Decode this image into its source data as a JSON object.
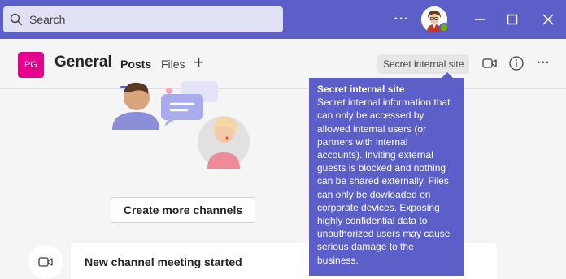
{
  "search": {
    "placeholder": "Search"
  },
  "titlebar": {
    "more": "···"
  },
  "team": {
    "initials": "PG"
  },
  "channel": {
    "title": "General",
    "tabs": [
      {
        "label": "Posts",
        "active": true
      },
      {
        "label": "Files",
        "active": false
      }
    ],
    "add_tab": "+",
    "sensitivity_label": "Secret internal site",
    "more": "···"
  },
  "tooltip": {
    "title": "Secret internal site",
    "body": "Secret internal information that can only be accessed by allowed internal users (or partners with internal accounts). Inviting external guests is blocked and nothing can be shared externally. Files can only be dowloaded on corporate devices. Exposing highly confidential data to unauthorized users may cause serious damage to the business."
  },
  "content": {
    "create_button": "Create more channels",
    "meeting_text": "New channel meeting started"
  },
  "colors": {
    "brand": "#5b5fc7",
    "team_avatar": "#e3008c",
    "presence": "#6bb700"
  }
}
